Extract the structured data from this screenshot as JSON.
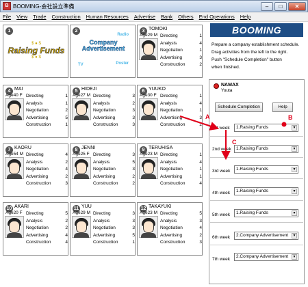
{
  "window": {
    "title": "BOOMING-会社設立準備",
    "app_icon_char": "B",
    "min_glyph": "–",
    "max_glyph": "□",
    "close_glyph": "✕"
  },
  "menu": [
    "File",
    "View",
    "Trade",
    "Construction",
    "Human Resources",
    "Advertise",
    "Bank",
    "Others",
    "End Operations",
    "Help"
  ],
  "promo": {
    "fund_title": "Raising Funds",
    "ad_title": "Company Advertisement",
    "ad_top": "Radio",
    "ad_left": "TV",
    "ad_right": "Poster",
    "num1": "1",
    "num2": "2"
  },
  "skill_labels": [
    "Directing",
    "Analysis",
    "Negotiation",
    "Advertising",
    "Construction"
  ],
  "cards": [
    {
      "num": "3",
      "name": "TOMOKI",
      "agesex": "Age29 M",
      "skills": [
        "1",
        "4",
        "1",
        "3",
        "2"
      ]
    },
    {
      "num": "4",
      "name": "MAI",
      "agesex": "Age40 F",
      "skills": [
        "1",
        "1",
        "2",
        "5",
        "1"
      ]
    },
    {
      "num": "5",
      "name": "HIDEJI",
      "agesex": "Age27 M",
      "skills": [
        "3",
        "2",
        "3",
        "3",
        "3"
      ]
    },
    {
      "num": "6",
      "name": "YUUKO",
      "agesex": "Age30 F",
      "skills": [
        "1",
        "4",
        "1",
        "3",
        "2"
      ]
    },
    {
      "num": "7",
      "name": "KAORU",
      "agesex": "Age54 M",
      "skills": [
        "4",
        "2",
        "4",
        "2",
        "3"
      ]
    },
    {
      "num": "8",
      "name": "JENNI",
      "agesex": "Age25 F",
      "skills": [
        "3",
        "5",
        "3",
        "2",
        "2"
      ]
    },
    {
      "num": "9",
      "name": "TERUHISA",
      "agesex": "Age23 M",
      "skills": [
        "1",
        "4",
        "1",
        "1",
        "4"
      ]
    },
    {
      "num": "10",
      "name": "AKARI",
      "agesex": "Age20 F",
      "skills": [
        "5",
        "2",
        "2",
        "4",
        "4"
      ]
    },
    {
      "num": "11",
      "name": "YUU",
      "agesex": "Age29 M",
      "skills": [
        "3",
        "3",
        "3",
        "5",
        "1"
      ]
    },
    {
      "num": "12",
      "name": "TAKAYUKI",
      "agesex": "Age23 M",
      "skills": [
        "5",
        "3",
        "4",
        "2",
        "3"
      ]
    }
  ],
  "right": {
    "banner": "BOOMING",
    "instructions": [
      "Prepare a company establishment schedule.",
      "Drag activities from the left to the right.",
      "Push \"Schedule Completion\" button",
      "when finished."
    ],
    "player": {
      "name": "NAMAX",
      "sub": "Youta"
    },
    "schedule_button": "Schedule Completion",
    "help_button": "Help",
    "weeks": [
      {
        "label": "1st week",
        "value": "1.Raising Funds"
      },
      {
        "label": "2nd week",
        "value": "1.Raising Funds"
      },
      {
        "label": "3rd week",
        "value": "1.Raising Funds"
      },
      {
        "label": "4th week",
        "value": "1.Raising Funds"
      },
      {
        "label": "5th week",
        "value": "1.Raising Funds"
      },
      {
        "label": "6th week",
        "value": "2.Company Advertisement"
      },
      {
        "label": "7th week",
        "value": "2.Company Advertisement"
      }
    ],
    "dropdown_arrow": "▼"
  },
  "annotations": {
    "a": "A",
    "b": "B",
    "c": "C"
  },
  "colors": {
    "annotation": "#e0001a",
    "banner": "#1e4d85",
    "fund_text": "#e8b800",
    "ad_text": "#4db8e8"
  }
}
